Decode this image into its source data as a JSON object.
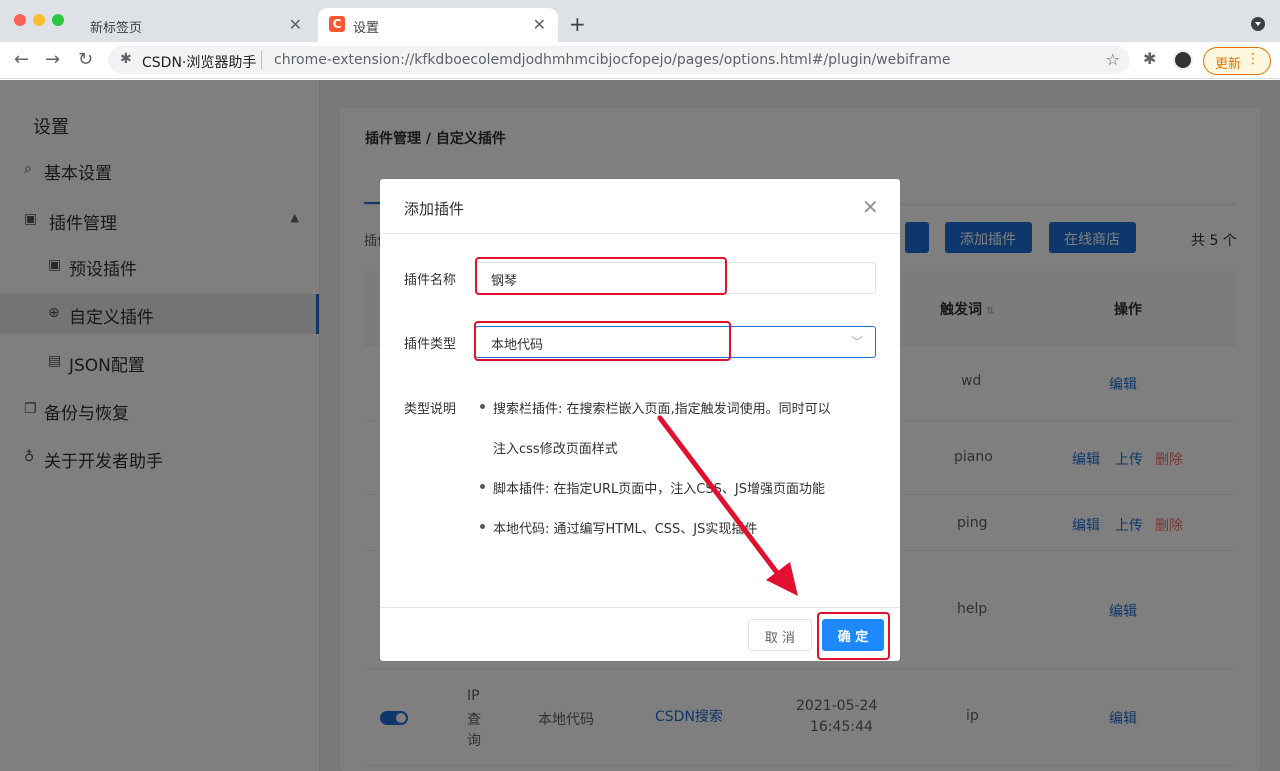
{
  "browser": {
    "tabs": [
      {
        "title": "新标签页",
        "active": false
      },
      {
        "title": "设置",
        "active": true
      }
    ],
    "omnibox": {
      "site": "CSDN·浏览器助手",
      "url": "chrome-extension://kfkdboecolemdjodhmhmcibjocfopejo/pages/options.html#/plugin/webiframe"
    },
    "update_label": "更新"
  },
  "sidebar": {
    "heading": "设置",
    "items": [
      {
        "label": "基本设置",
        "icon": "search-icon"
      },
      {
        "label": "插件管理",
        "icon": "briefcase-icon"
      },
      {
        "label": "预设插件",
        "icon": "briefcase-icon"
      },
      {
        "label": "自定义插件",
        "icon": "globe-icon"
      },
      {
        "label": "JSON配置",
        "icon": "file-icon"
      },
      {
        "label": "备份与恢复",
        "icon": "copy-icon"
      },
      {
        "label": "关于开发者助手",
        "icon": "bulb-icon"
      }
    ]
  },
  "main": {
    "breadcrumb": "插件管理 / 自定义插件",
    "filter_label": "插件",
    "buttons": {
      "add": "添加插件",
      "store": "在线商店"
    },
    "total": "共 5 个",
    "table": {
      "headers": {
        "trigger": "触发词",
        "actions": "操作"
      },
      "rows": [
        {
          "trigger": "wd",
          "actions": [
            "编辑"
          ]
        },
        {
          "trigger": "piano",
          "actions": [
            "编辑",
            "上传",
            "删除"
          ]
        },
        {
          "trigger": "ping",
          "actions": [
            "编辑",
            "上传",
            "删除"
          ]
        },
        {
          "trigger": "help",
          "actions": [
            "编辑"
          ]
        },
        {
          "name_lines": [
            "IP",
            "查",
            "询"
          ],
          "type": "本地代码",
          "source": "CSDN搜索",
          "date": "2021-05-24",
          "time": "16:45:44",
          "trigger": "ip",
          "actions": [
            "编辑"
          ]
        }
      ]
    }
  },
  "dialog": {
    "title": "添加插件",
    "name_label": "插件名称",
    "name_value": "钢琴",
    "type_label": "插件类型",
    "type_value": "本地代码",
    "desc_label": "类型说明",
    "desc_lines": [
      "搜索栏插件: 在搜索栏嵌入页面,指定触发词使用。同时可以",
      "注入css修改页面样式",
      "脚本插件: 在指定URL页面中，注入CSS、JS增强页面功能",
      "本地代码: 通过编写HTML、CSS、JS实现插件"
    ],
    "cancel_label": "取 消",
    "ok_label": "确 定"
  },
  "colors": {
    "accent": "#1e6fd6",
    "annotation": "#e0102e",
    "danger": "#f56c6c"
  }
}
